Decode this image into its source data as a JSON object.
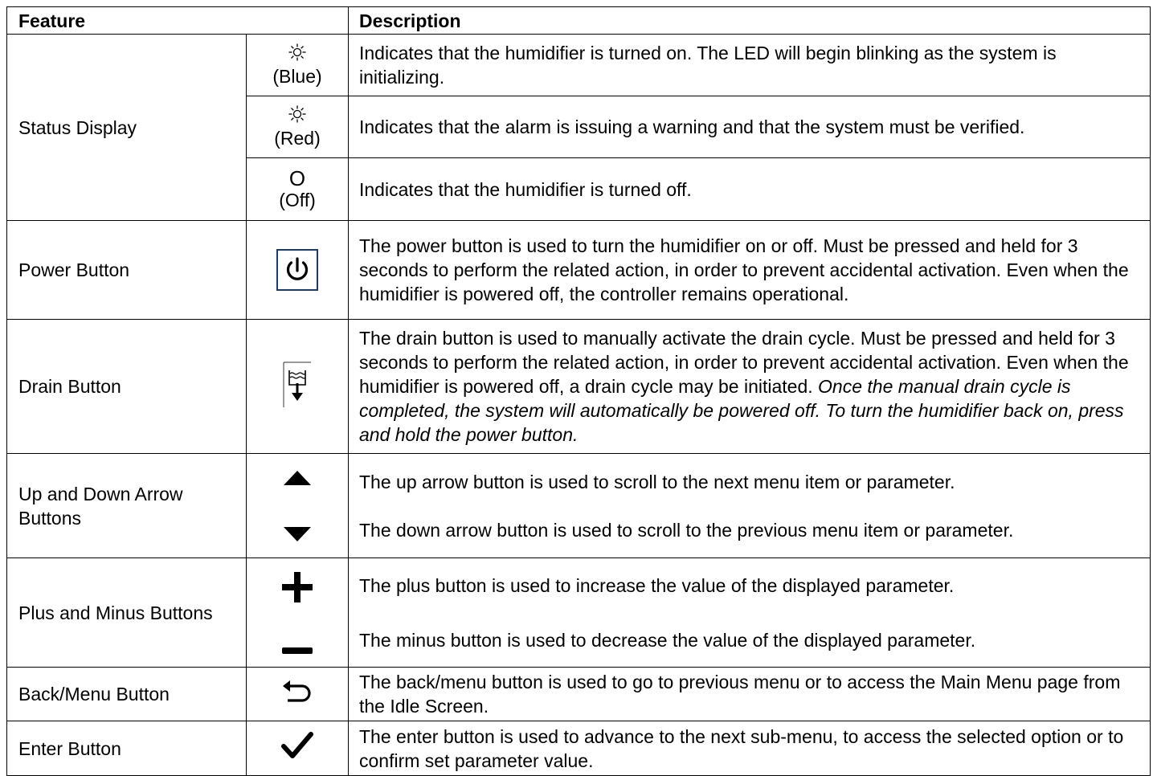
{
  "headers": {
    "feature": "Feature",
    "description": "Description"
  },
  "status": {
    "feature": "Status Display",
    "rows": [
      {
        "icon": "sun-icon",
        "color_label": "(Blue)",
        "description": "Indicates that the humidifier is turned on. The LED will begin blinking as the system is initializing."
      },
      {
        "icon": "sun-icon",
        "color_label": "(Red)",
        "description": "Indicates that the alarm is issuing a warning and that the system must be verified."
      },
      {
        "symbol": "O",
        "color_label": "(Off)",
        "description": "Indicates that the humidifier is turned off."
      }
    ]
  },
  "power": {
    "feature": "Power Button",
    "icon": "power-icon",
    "description": "The power button is used to turn the humidifier on or off. Must be pressed and held for 3 seconds to perform the related action, in order to prevent accidental activation. Even when the humidifier is powered off, the controller remains operational."
  },
  "drain": {
    "feature": "Drain Button",
    "icon": "drain-icon",
    "description": "The drain button is used to manually activate the drain cycle. Must be pressed and held for 3 seconds to perform the related action, in order to prevent accidental activation. Even when the humidifier is powered off, a drain cycle may be initiated.",
    "description_italic": "Once the manual drain cycle is completed, the system will automatically be powered off. To turn the humidifier back on, press and hold the power button."
  },
  "arrows": {
    "feature": "Up and Down Arrow Buttons",
    "up_icon": "triangle-up-icon",
    "down_icon": "triangle-down-icon",
    "up_description": "The up arrow button is used to scroll to the next menu item or parameter.",
    "down_description": "The down arrow button is used to scroll to the previous menu item or parameter."
  },
  "plusminus": {
    "feature": "Plus and Minus Buttons",
    "plus_icon": "plus-icon",
    "minus_icon": "minus-icon",
    "plus_description": "The plus button is used to increase the value of the displayed parameter.",
    "minus_description": "The minus button is used to decrease the value of the displayed parameter."
  },
  "back": {
    "feature": "Back/Menu Button",
    "icon": "back-arrow-icon",
    "description": "The back/menu button is used to go to previous menu or to access the Main Menu page from the Idle Screen."
  },
  "enter": {
    "feature": "Enter Button",
    "icon": "checkmark-icon",
    "description": "The enter button is used to advance to the next sub-menu, to access the selected option or to confirm set parameter value."
  },
  "colors": {
    "border": "#000000",
    "power_box": "#1f3a5a",
    "text": "#000000"
  }
}
